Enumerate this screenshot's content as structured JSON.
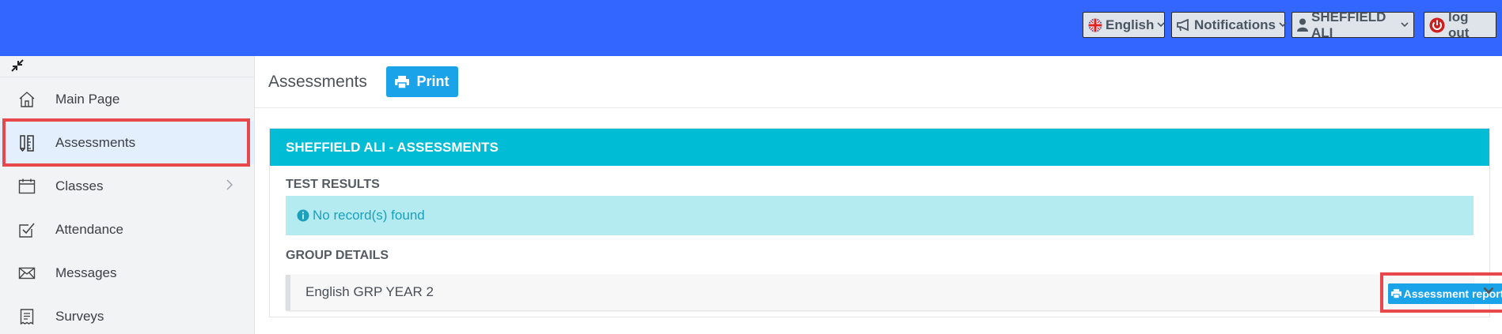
{
  "topbar": {
    "language": {
      "label": "English",
      "flag_icon": "uk-flag-icon"
    },
    "notifications": {
      "label": "Notifications",
      "icon": "megaphone-icon"
    },
    "user": {
      "label": "SHEFFIELD ALI",
      "icon": "user-icon"
    },
    "logout": {
      "label": "log out",
      "icon": "power-icon"
    },
    "colors": {
      "bar": "#3366ff",
      "logout_icon": "#cc1f1f"
    }
  },
  "sidebar": {
    "collapse_icon": "collapse-arrows-icon",
    "items": [
      {
        "label": "Main Page",
        "icon": "home-icon"
      },
      {
        "label": "Assessments",
        "icon": "ruler-pencil-icon",
        "active": true
      },
      {
        "label": "Classes",
        "icon": "calendar-icon",
        "has_submenu": true
      },
      {
        "label": "Attendance",
        "icon": "checkbox-icon"
      },
      {
        "label": "Messages",
        "icon": "envelope-icon"
      },
      {
        "label": "Surveys",
        "icon": "clipboard-icon"
      }
    ]
  },
  "main": {
    "title": "Assessments",
    "print_label": "Print",
    "panel": {
      "heading": "SHEFFIELD ALI - ASSESSMENTS",
      "test_results_label": "TEST RESULTS",
      "no_records": "No record(s) found",
      "group_details_label": "GROUP DETAILS",
      "group": {
        "name": "English GRP YEAR 2",
        "report_label": "Assessment report"
      }
    },
    "colors": {
      "accent": "#00bcd4",
      "button": "#1aa3e8",
      "alert_bg": "#b3ebf1",
      "highlight": "#e8474c"
    }
  }
}
